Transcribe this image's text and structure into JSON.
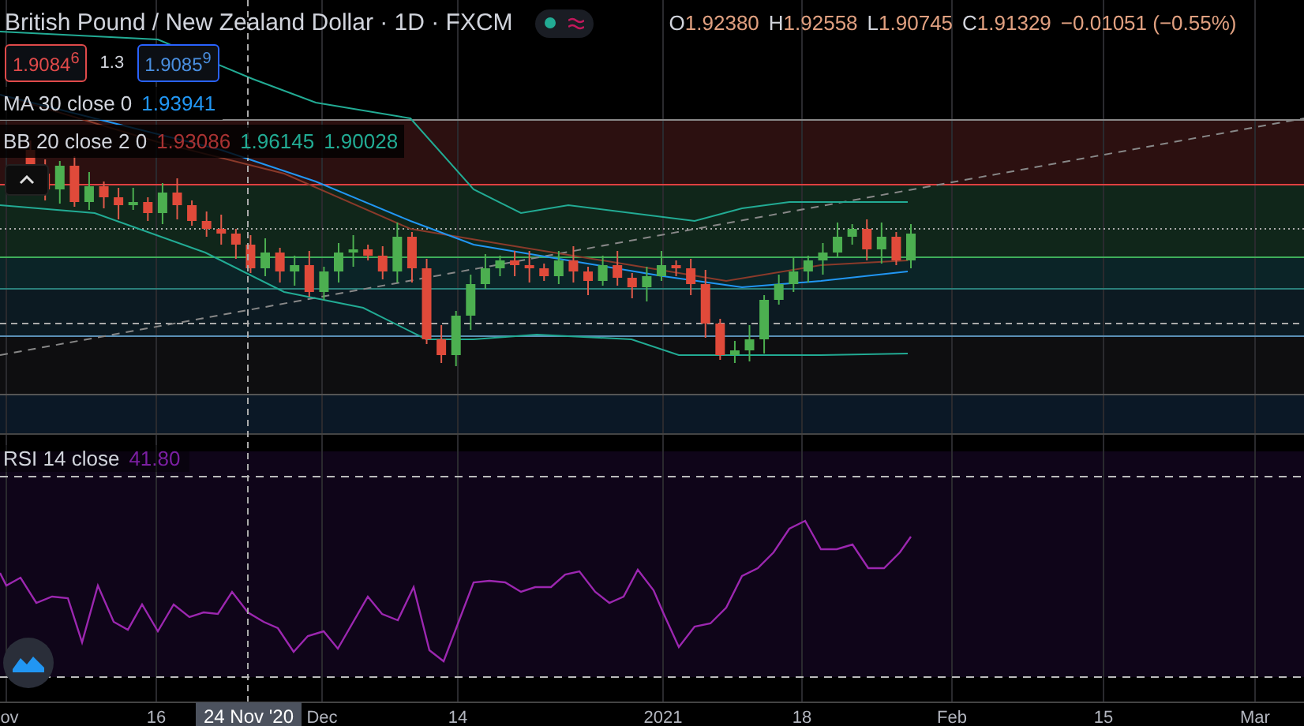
{
  "header": {
    "symbol": "British Pound / New Zealand Dollar · 1D · FXCM",
    "market_open": true,
    "ohlc": [
      {
        "label": "O",
        "value": "1.92380"
      },
      {
        "label": "H",
        "value": "1.92558"
      },
      {
        "label": "L",
        "value": "1.90745"
      },
      {
        "label": "C",
        "value": "1.91329"
      }
    ],
    "change": "−0.01051 (−0.55%)"
  },
  "trade": {
    "sell": "1.9084$^{6}$",
    "spread": "1.3",
    "buy": "1.9085$^{9}$"
  },
  "indicators": [
    {
      "name": "MA 30 close 0",
      "values": [
        {
          "text": "1.93941",
          "color": "#2196f3"
        }
      ]
    },
    {
      "name": "BB 20 close 2 0",
      "values": [
        {
          "text": "1.93086",
          "color": "#a83232"
        },
        {
          "text": "1.96145",
          "color": "#22ab94"
        },
        {
          "text": "1.90028",
          "color": "#22ab94"
        }
      ]
    }
  ],
  "rsi": {
    "name": "RSI 14 close",
    "value": "41.80"
  },
  "time_axis": {
    "labels": [
      "ov",
      "16",
      "Dec",
      "14",
      "2021",
      "18",
      "Feb",
      "15",
      "Mar"
    ],
    "crosshair": "24 Nov '20"
  }
}
